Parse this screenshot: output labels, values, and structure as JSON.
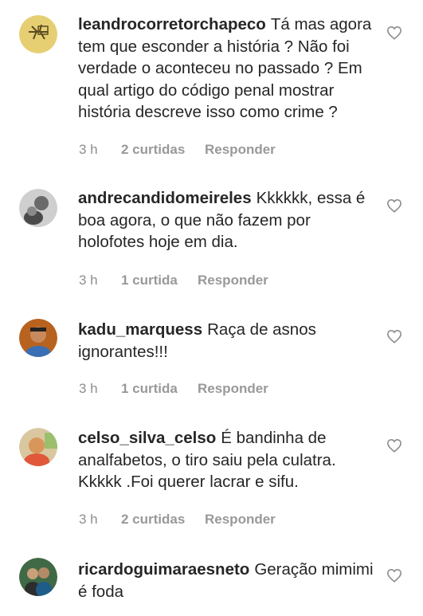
{
  "comments": [
    {
      "username": "leandrocorretorchapeco",
      "text": "Tá mas agora tem que esconder a história ? Não foi verdade o aconteceu no passado ? Em qual artigo do código penal mostrar história descreve isso como crime ?",
      "time": "3 h",
      "likes": "2 curtidas",
      "reply": "Responder",
      "avatar_color": "#e6cf73"
    },
    {
      "username": "andrecandidomeireles",
      "text": "Kkkkkk, essa é boa agora, o que não fazem por holofotes hoje em dia.",
      "time": "3 h",
      "likes": "1 curtida",
      "reply": "Responder",
      "avatar_color": "#9a9a9a"
    },
    {
      "username": "kadu_marquess",
      "text": "Raça de asnos ignorantes!!!",
      "time": "3 h",
      "likes": "1 curtida",
      "reply": "Responder",
      "avatar_color": "#b8621f"
    },
    {
      "username": "celso_silva_celso",
      "text": "É bandinha de analfabetos, o tiro saiu pela culatra. Kkkkk .Foi querer lacrar e sifu.",
      "time": "3 h",
      "likes": "2 curtidas",
      "reply": "Responder",
      "avatar_color": "#d9965a"
    },
    {
      "username": "ricardoguimaraesneto",
      "text": "Geração mimimi é foda",
      "avatar_color": "#3f6a45"
    }
  ],
  "icons": {
    "like": "heart-outline-icon"
  }
}
